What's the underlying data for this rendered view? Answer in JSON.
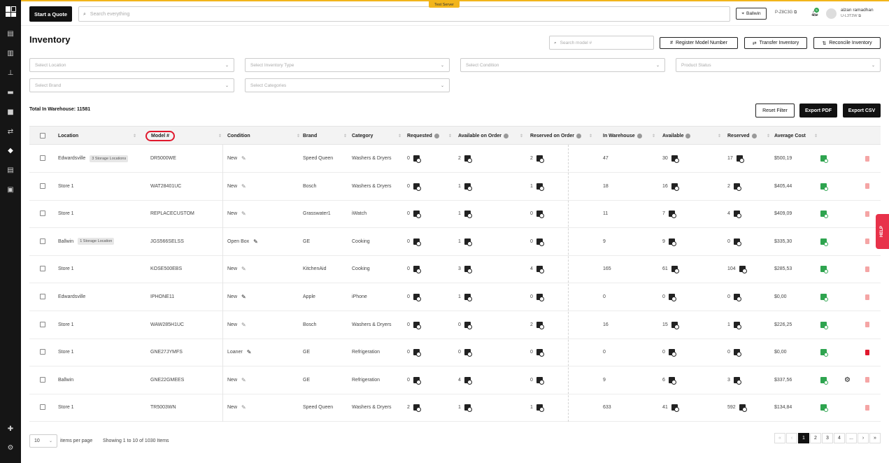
{
  "topbar": {
    "start_quote": "Start a Quote",
    "search_placeholder": "Search everything",
    "server_badge": "Test Server",
    "location": "Ballwin",
    "store_code": "P-Z8C3G",
    "notification_count": "5",
    "user_name": "alzan ramadhan",
    "user_id": "U-L3T3W"
  },
  "page": {
    "title": "Inventory",
    "model_search_placeholder": "Search model #",
    "register_label": "Register Model Number",
    "transfer_label": "Transfer Inventory",
    "reconcile_label": "Reconcile Inventory"
  },
  "filters": {
    "location": "Select Location",
    "inventory_type": "Select Inventory Type",
    "condition": "Select Condition",
    "product_status": "Product Status",
    "brand": "Select Brand",
    "categories": "Select Categories"
  },
  "summary": {
    "total": "Total In Warehouse: 11581",
    "reset": "Reset Filter",
    "export_pdf": "Export PDF",
    "export_csv": "Export CSV"
  },
  "columns": {
    "location": "Location",
    "model": "Model #",
    "condition": "Condition",
    "brand": "Brand",
    "category": "Category",
    "requested": "Requested",
    "available_on_order": "Available on Order",
    "reserved_on_order": "Reserved on Order",
    "in_warehouse": "In Warehouse",
    "available": "Available",
    "reserved": "Reserved",
    "average_cost": "Average Cost"
  },
  "rows": [
    {
      "location": "Edwardsville",
      "tag": "3 Storage Locations",
      "model": "DR5000WE",
      "condition": "New",
      "brand": "Speed Queen",
      "category": "Washers & Dryers",
      "requested": "0",
      "aoo": "2",
      "roo": "2",
      "inw": "47",
      "avail": "30",
      "reserved": "17",
      "cost": "$500,19"
    },
    {
      "location": "Store 1",
      "tag": "",
      "model": "WAT28401UC",
      "condition": "New",
      "brand": "Bosch",
      "category": "Washers & Dryers",
      "requested": "0",
      "aoo": "1",
      "roo": "1",
      "inw": "18",
      "avail": "16",
      "reserved": "2",
      "cost": "$405,44"
    },
    {
      "location": "Store 1",
      "tag": "",
      "model": "REPLACECUSTOM",
      "condition": "New",
      "brand": "Grasswater1",
      "category": "iWatch",
      "requested": "0",
      "aoo": "1",
      "roo": "0",
      "inw": "11",
      "avail": "7",
      "reserved": "4",
      "cost": "$409,09"
    },
    {
      "location": "Ballwin",
      "tag": "1 Storage Location",
      "model": "JGS566SELSS",
      "condition": "Open Box",
      "brand": "GE",
      "category": "Cooking",
      "requested": "0",
      "aoo": "1",
      "roo": "0",
      "inw": "9",
      "avail": "9",
      "reserved": "0",
      "cost": "$335,30"
    },
    {
      "location": "Store 1",
      "tag": "",
      "model": "KOSE500EBS",
      "condition": "New",
      "brand": "KitchenAid",
      "category": "Cooking",
      "requested": "0",
      "aoo": "3",
      "roo": "4",
      "inw": "165",
      "avail": "61",
      "reserved": "104",
      "cost": "$285,53"
    },
    {
      "location": "Edwardsville",
      "tag": "",
      "model": "IPHONE11",
      "condition": "New",
      "brand": "Apple",
      "category": "iPhone",
      "requested": "0",
      "aoo": "1",
      "roo": "0",
      "inw": "0",
      "avail": "0",
      "reserved": "0",
      "cost": "$0,00"
    },
    {
      "location": "Store 1",
      "tag": "",
      "model": "WAW285H1UC",
      "condition": "New",
      "brand": "Bosch",
      "category": "Washers & Dryers",
      "requested": "0",
      "aoo": "0",
      "roo": "2",
      "inw": "16",
      "avail": "15",
      "reserved": "1",
      "cost": "$226,25"
    },
    {
      "location": "Store 1",
      "tag": "",
      "model": "GNE27JYMFS",
      "condition": "Loaner",
      "brand": "GE",
      "category": "Refrigeration",
      "requested": "0",
      "aoo": "0",
      "roo": "0",
      "inw": "0",
      "avail": "0",
      "reserved": "0",
      "cost": "$0,00"
    },
    {
      "location": "Ballwin",
      "tag": "",
      "model": "GNE22GMEES",
      "condition": "New",
      "brand": "GE",
      "category": "Refrigeration",
      "requested": "0",
      "aoo": "4",
      "roo": "0",
      "inw": "9",
      "avail": "6",
      "reserved": "3",
      "cost": "$337,56"
    },
    {
      "location": "Store 1",
      "tag": "",
      "model": "TR5003WN",
      "condition": "New",
      "brand": "Speed Queen",
      "category": "Washers & Dryers",
      "requested": "2",
      "aoo": "1",
      "roo": "1",
      "inw": "633",
      "avail": "41",
      "reserved": "592",
      "cost": "$134,84"
    }
  ],
  "row_flags": {
    "dark_pencil_rows": [
      3,
      5,
      7
    ],
    "red_trash_rows": [
      7
    ],
    "gear_rows": [
      8
    ]
  },
  "footer": {
    "per_page": "10",
    "per_page_label": "items per page",
    "showing": "Showing 1 to 10 of 1030 Items",
    "pages": [
      "«",
      "‹",
      "1",
      "2",
      "3",
      "4",
      "...",
      "›",
      "»"
    ],
    "current_page": "1"
  },
  "help": "HELP",
  "colors": {
    "accent": "#f2b51b",
    "primary": "#111111",
    "success": "#2ea44f",
    "danger": "#e0182d",
    "help": "#e8324a"
  }
}
